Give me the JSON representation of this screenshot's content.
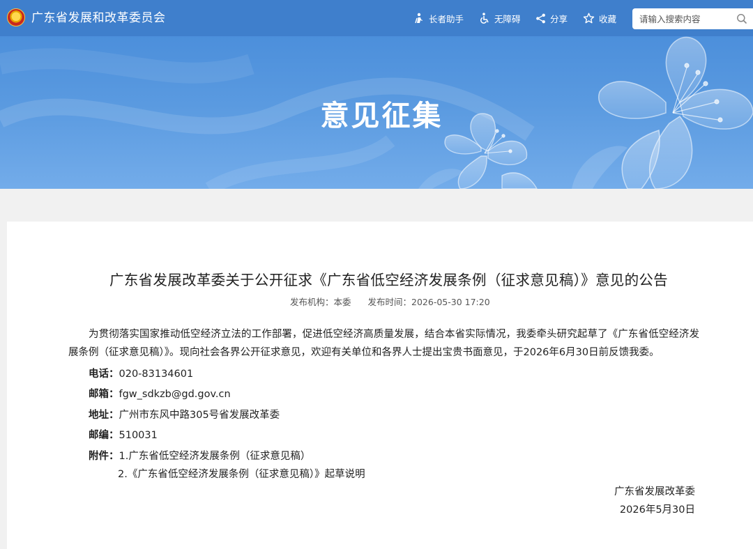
{
  "header": {
    "site_name": "广东省发展和改革委员会",
    "tools": {
      "elder": "长者助手",
      "accessibility": "无障碍",
      "share": "分享",
      "favorite": "收藏"
    },
    "search": {
      "placeholder": "请输入搜索内容"
    }
  },
  "banner": {
    "title": "意见征集"
  },
  "article": {
    "title": "广东省发展改革委关于公开征求《广东省低空经济发展条例（征求意见稿）》意见的公告",
    "meta": {
      "publisher_label": "发布机构：",
      "publisher": "本委",
      "time_label": "发布时间：",
      "time": "2026-05-30 17:20"
    },
    "body": "为贯彻落实国家推动低空经济立法的工作部署，促进低空经济高质量发展，结合本省实际情况，我委牵头研究起草了《广东省低空经济发展条例（征求意见稿）》。现向社会各界公开征求意见，欢迎有关单位和各界人士提出宝贵书面意见，于2026年6月30日前反馈我委。",
    "contacts": {
      "phone_label": "电话：",
      "phone": "020-83134601",
      "email_label": "邮箱：",
      "email": "fgw_sdkzb@gd.gov.cn",
      "address_label": "地址：",
      "address": "广州市东风中路305号省发展改革委",
      "postcode_label": "邮编：",
      "postcode": "510031"
    },
    "attachments": {
      "label": "附件：",
      "items": [
        "1.广东省低空经济发展条例（征求意见稿）",
        "2.《广东省低空经济发展条例（征求意见稿）》起草说明"
      ]
    },
    "signature": {
      "org": "广东省发展改革委",
      "date": "2026年5月30日"
    }
  },
  "colors": {
    "header_bg": "#3f7fcc",
    "banner_bg": "#5a9ae0",
    "page_bg": "#f1f1f1",
    "card_bg": "#ffffff"
  }
}
